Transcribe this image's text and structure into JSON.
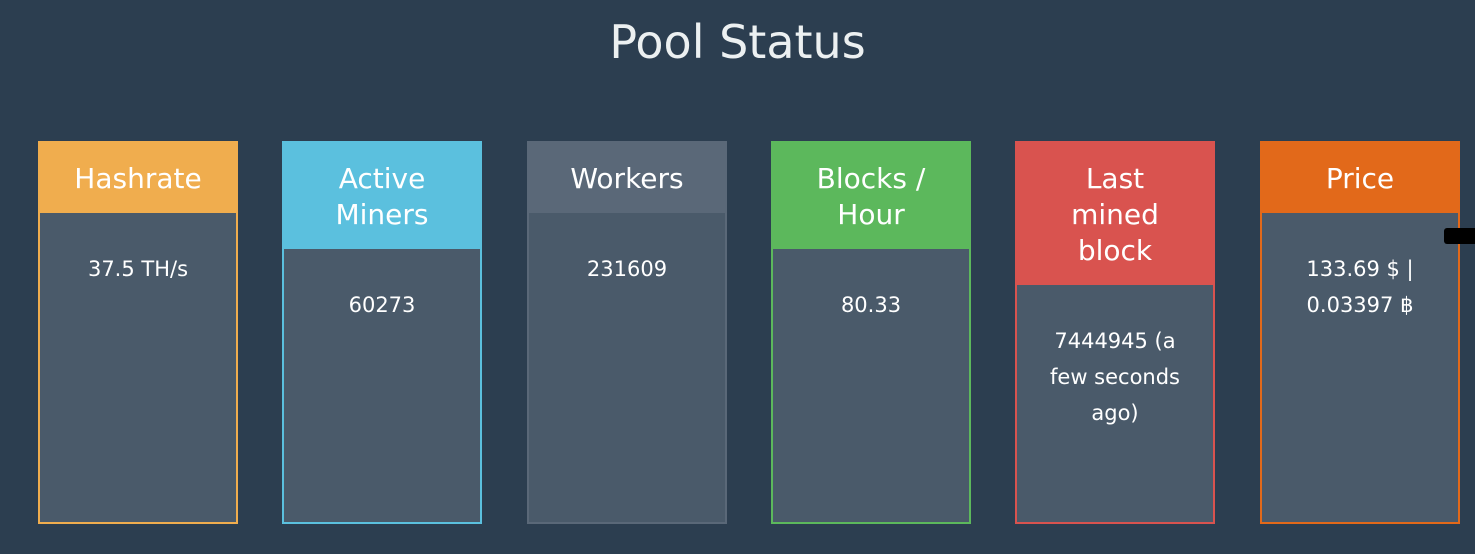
{
  "page": {
    "title": "Pool Status"
  },
  "panels": [
    {
      "key": "hashrate",
      "heading": "Hashrate",
      "value": "37.5 TH/s",
      "color": "#f0ad4e"
    },
    {
      "key": "active-miners",
      "heading": "Active Miners",
      "value": "60273",
      "color": "#5bc0de"
    },
    {
      "key": "workers",
      "heading": "Workers",
      "value": "231609",
      "color": "#5a6878"
    },
    {
      "key": "blocks-hour",
      "heading": "Blocks / Hour",
      "value": "80.33",
      "color": "#5cb85c"
    },
    {
      "key": "last-mined-block",
      "heading": "Last mined block",
      "value": "7444945 (a few seconds ago)",
      "color": "#d9534f"
    },
    {
      "key": "price",
      "heading": "Price",
      "value": "133.69 $ | 0.03397 ฿",
      "color": "#e2691a"
    }
  ],
  "colors": {
    "background": "#2c3e50",
    "panel_body": "#4a5a6a",
    "text": "#ecf0f1"
  }
}
